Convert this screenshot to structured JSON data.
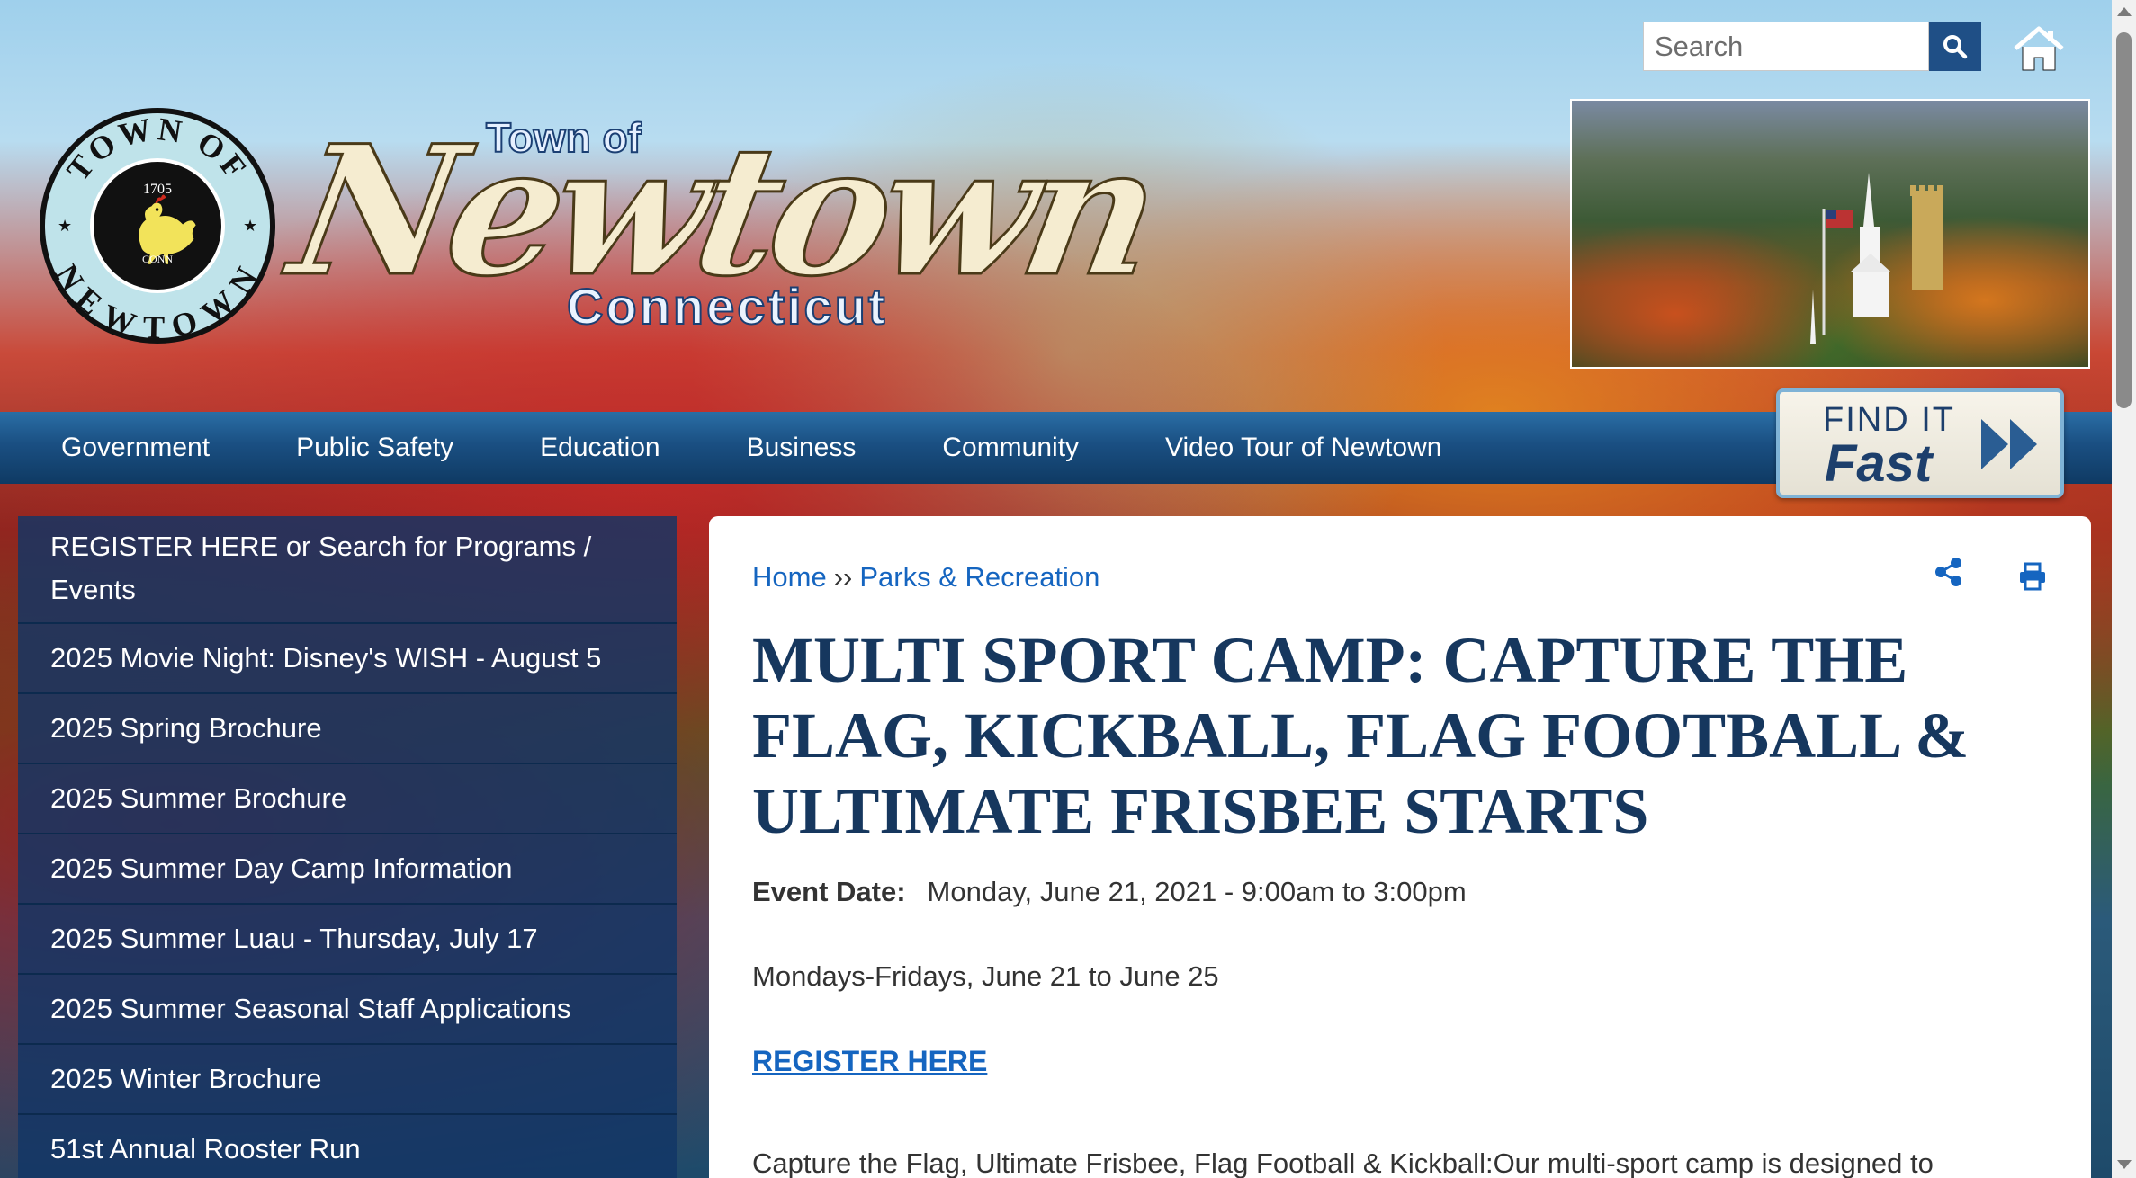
{
  "header": {
    "seal": {
      "top_text": "TOWN OF",
      "bottom_text": "NEWTOWN",
      "year": "1705",
      "abbr": "CONN"
    },
    "wordmark": {
      "line1": "Town of",
      "line2": "Newtown",
      "line3": "Connecticut"
    },
    "search": {
      "placeholder": "Search"
    },
    "icons": {
      "search": "search-icon",
      "home": "home-icon"
    }
  },
  "nav": {
    "items": [
      "Government",
      "Public Safety",
      "Education",
      "Business",
      "Community",
      "Video Tour of Newtown"
    ],
    "find_it_fast": {
      "top": "FIND IT",
      "bottom": "Fast"
    }
  },
  "sidebar": {
    "items": [
      "REGISTER HERE or Search for Programs / Events",
      "2025 Movie Night: Disney's WISH - August 5",
      "2025 Spring Brochure",
      "2025 Summer Brochure",
      "2025 Summer Day Camp Information",
      "2025 Summer Luau - Thursday, July 17",
      "2025 Summer Seasonal Staff Applications",
      "2025 Winter Brochure",
      "51st Annual Rooster Run"
    ]
  },
  "content": {
    "breadcrumb": {
      "home": "Home",
      "separator": "››",
      "current": "Parks & Recreation"
    },
    "title": "MULTI SPORT CAMP: CAPTURE THE FLAG, KICKBALL, FLAG FOOTBALL & ULTIMATE FRISBEE STARTS",
    "event_date_label": "Event Date:",
    "event_date_value": "Monday, June 21, 2021 - 9:00am to 3:00pm",
    "dates": "Mondays-Fridays, June 21 to June 25",
    "register_link": "REGISTER HERE",
    "description": "Capture the Flag, Ultimate Frisbee, Flag Football & Kickball:Our multi-sport camp is designed to",
    "icons": {
      "share": "share-icon",
      "print": "print-icon"
    }
  },
  "colors": {
    "nav_blue": "#1a4f82",
    "sidebar_blue": "#113666",
    "title_navy": "#16375e",
    "link_blue": "#1565c0"
  }
}
